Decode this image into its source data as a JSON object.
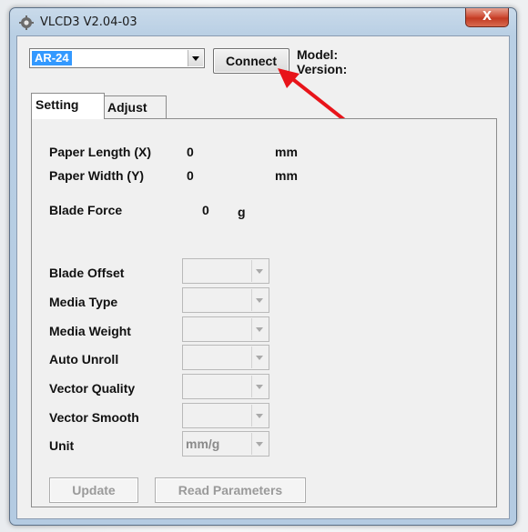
{
  "window": {
    "title": "VLCD3 V2.04-03",
    "close_label": "X"
  },
  "toolbar": {
    "device_select_value": "AR-24",
    "connect_label": "Connect",
    "model_label": "Model:",
    "version_label": "Version:"
  },
  "tabs": [
    {
      "label": "Setting",
      "active": true
    },
    {
      "label": "Adjust",
      "active": false
    }
  ],
  "setting": {
    "paper_length": {
      "label": "Paper Length (X)",
      "value": "0",
      "unit": "mm"
    },
    "paper_width": {
      "label": "Paper Width (Y)",
      "value": "0",
      "unit": "mm"
    },
    "blade_force": {
      "label": "Blade Force",
      "value": "0",
      "unit": "g"
    },
    "fields": [
      {
        "label": "Blade Offset",
        "value": ""
      },
      {
        "label": "Media Type",
        "value": ""
      },
      {
        "label": "Media Weight",
        "value": ""
      },
      {
        "label": "Auto Unroll",
        "value": ""
      },
      {
        "label": "Vector Quality",
        "value": ""
      },
      {
        "label": "Vector Smooth",
        "value": ""
      },
      {
        "label": "Unit",
        "value": "mm/g"
      }
    ],
    "update_label": "Update",
    "read_parameters_label": "Read Parameters"
  },
  "annotation": {
    "color": "#e8141a"
  },
  "colors": {
    "selection": "#3399ff",
    "close_button": "#c9452d"
  }
}
